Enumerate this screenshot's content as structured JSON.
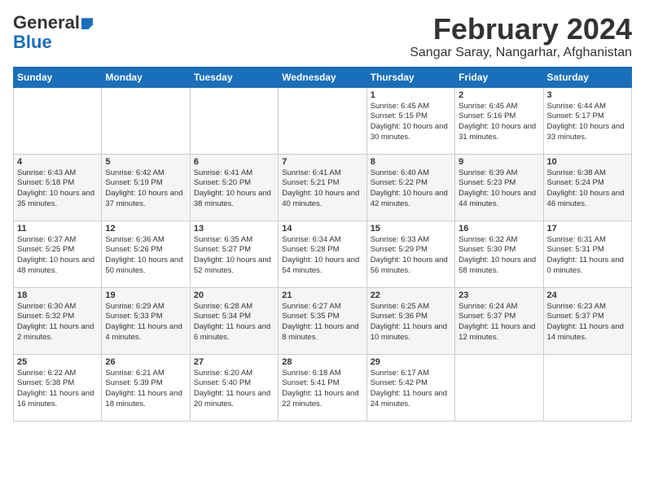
{
  "logo": {
    "general": "General",
    "blue": "Blue"
  },
  "title": "February 2024",
  "location": "Sangar Saray, Nangarhar, Afghanistan",
  "days": [
    "Sunday",
    "Monday",
    "Tuesday",
    "Wednesday",
    "Thursday",
    "Friday",
    "Saturday"
  ],
  "weeks": [
    [
      {
        "day": "",
        "content": ""
      },
      {
        "day": "",
        "content": ""
      },
      {
        "day": "",
        "content": ""
      },
      {
        "day": "",
        "content": ""
      },
      {
        "day": "1",
        "content": "Sunrise: 6:45 AM\nSunset: 5:15 PM\nDaylight: 10 hours\nand 30 minutes."
      },
      {
        "day": "2",
        "content": "Sunrise: 6:45 AM\nSunset: 5:16 PM\nDaylight: 10 hours\nand 31 minutes."
      },
      {
        "day": "3",
        "content": "Sunrise: 6:44 AM\nSunset: 5:17 PM\nDaylight: 10 hours\nand 33 minutes."
      }
    ],
    [
      {
        "day": "4",
        "content": "Sunrise: 6:43 AM\nSunset: 5:18 PM\nDaylight: 10 hours\nand 35 minutes."
      },
      {
        "day": "5",
        "content": "Sunrise: 6:42 AM\nSunset: 5:19 PM\nDaylight: 10 hours\nand 37 minutes."
      },
      {
        "day": "6",
        "content": "Sunrise: 6:41 AM\nSunset: 5:20 PM\nDaylight: 10 hours\nand 38 minutes."
      },
      {
        "day": "7",
        "content": "Sunrise: 6:41 AM\nSunset: 5:21 PM\nDaylight: 10 hours\nand 40 minutes."
      },
      {
        "day": "8",
        "content": "Sunrise: 6:40 AM\nSunset: 5:22 PM\nDaylight: 10 hours\nand 42 minutes."
      },
      {
        "day": "9",
        "content": "Sunrise: 6:39 AM\nSunset: 5:23 PM\nDaylight: 10 hours\nand 44 minutes."
      },
      {
        "day": "10",
        "content": "Sunrise: 6:38 AM\nSunset: 5:24 PM\nDaylight: 10 hours\nand 46 minutes."
      }
    ],
    [
      {
        "day": "11",
        "content": "Sunrise: 6:37 AM\nSunset: 5:25 PM\nDaylight: 10 hours\nand 48 minutes."
      },
      {
        "day": "12",
        "content": "Sunrise: 6:36 AM\nSunset: 5:26 PM\nDaylight: 10 hours\nand 50 minutes."
      },
      {
        "day": "13",
        "content": "Sunrise: 6:35 AM\nSunset: 5:27 PM\nDaylight: 10 hours\nand 52 minutes."
      },
      {
        "day": "14",
        "content": "Sunrise: 6:34 AM\nSunset: 5:28 PM\nDaylight: 10 hours\nand 54 minutes."
      },
      {
        "day": "15",
        "content": "Sunrise: 6:33 AM\nSunset: 5:29 PM\nDaylight: 10 hours\nand 56 minutes."
      },
      {
        "day": "16",
        "content": "Sunrise: 6:32 AM\nSunset: 5:30 PM\nDaylight: 10 hours\nand 58 minutes."
      },
      {
        "day": "17",
        "content": "Sunrise: 6:31 AM\nSunset: 5:31 PM\nDaylight: 11 hours\nand 0 minutes."
      }
    ],
    [
      {
        "day": "18",
        "content": "Sunrise: 6:30 AM\nSunset: 5:32 PM\nDaylight: 11 hours\nand 2 minutes."
      },
      {
        "day": "19",
        "content": "Sunrise: 6:29 AM\nSunset: 5:33 PM\nDaylight: 11 hours\nand 4 minutes."
      },
      {
        "day": "20",
        "content": "Sunrise: 6:28 AM\nSunset: 5:34 PM\nDaylight: 11 hours\nand 6 minutes."
      },
      {
        "day": "21",
        "content": "Sunrise: 6:27 AM\nSunset: 5:35 PM\nDaylight: 11 hours\nand 8 minutes."
      },
      {
        "day": "22",
        "content": "Sunrise: 6:25 AM\nSunset: 5:36 PM\nDaylight: 11 hours\nand 10 minutes."
      },
      {
        "day": "23",
        "content": "Sunrise: 6:24 AM\nSunset: 5:37 PM\nDaylight: 11 hours\nand 12 minutes."
      },
      {
        "day": "24",
        "content": "Sunrise: 6:23 AM\nSunset: 5:37 PM\nDaylight: 11 hours\nand 14 minutes."
      }
    ],
    [
      {
        "day": "25",
        "content": "Sunrise: 6:22 AM\nSunset: 5:38 PM\nDaylight: 11 hours\nand 16 minutes."
      },
      {
        "day": "26",
        "content": "Sunrise: 6:21 AM\nSunset: 5:39 PM\nDaylight: 11 hours\nand 18 minutes."
      },
      {
        "day": "27",
        "content": "Sunrise: 6:20 AM\nSunset: 5:40 PM\nDaylight: 11 hours\nand 20 minutes."
      },
      {
        "day": "28",
        "content": "Sunrise: 6:18 AM\nSunset: 5:41 PM\nDaylight: 11 hours\nand 22 minutes."
      },
      {
        "day": "29",
        "content": "Sunrise: 6:17 AM\nSunset: 5:42 PM\nDaylight: 11 hours\nand 24 minutes."
      },
      {
        "day": "",
        "content": ""
      },
      {
        "day": "",
        "content": ""
      }
    ]
  ]
}
